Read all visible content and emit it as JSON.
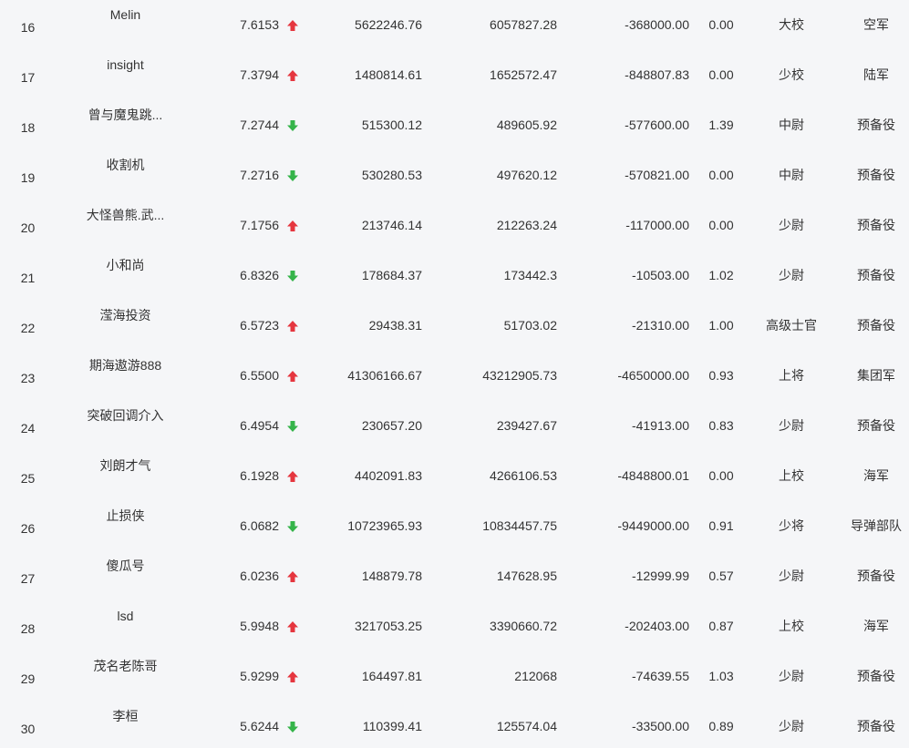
{
  "colors": {
    "up": "#e5363f",
    "down": "#35b44a",
    "background": "#f5f6f8",
    "text": "#333333"
  },
  "rows": [
    {
      "rank": "16",
      "name": "Melin",
      "score": "7.6153",
      "trend": "up",
      "v1": "5622246.76",
      "v2": "6057827.28",
      "v3": "-368000.00",
      "v4": "0.00",
      "title": "大校",
      "branch": "空军"
    },
    {
      "rank": "17",
      "name": "insight",
      "score": "7.3794",
      "trend": "up",
      "v1": "1480814.61",
      "v2": "1652572.47",
      "v3": "-848807.83",
      "v4": "0.00",
      "title": "少校",
      "branch": "陆军"
    },
    {
      "rank": "18",
      "name": "曾与魔鬼跳...",
      "score": "7.2744",
      "trend": "down",
      "v1": "515300.12",
      "v2": "489605.92",
      "v3": "-577600.00",
      "v4": "1.39",
      "title": "中尉",
      "branch": "预备役"
    },
    {
      "rank": "19",
      "name": "收割机",
      "score": "7.2716",
      "trend": "down",
      "v1": "530280.53",
      "v2": "497620.12",
      "v3": "-570821.00",
      "v4": "0.00",
      "title": "中尉",
      "branch": "预备役"
    },
    {
      "rank": "20",
      "name": "大怪兽熊.武...",
      "score": "7.1756",
      "trend": "up",
      "v1": "213746.14",
      "v2": "212263.24",
      "v3": "-117000.00",
      "v4": "0.00",
      "title": "少尉",
      "branch": "预备役"
    },
    {
      "rank": "21",
      "name": "小和尚",
      "score": "6.8326",
      "trend": "down",
      "v1": "178684.37",
      "v2": "173442.3",
      "v3": "-10503.00",
      "v4": "1.02",
      "title": "少尉",
      "branch": "预备役"
    },
    {
      "rank": "22",
      "name": "滢海投资",
      "score": "6.5723",
      "trend": "up",
      "v1": "29438.31",
      "v2": "51703.02",
      "v3": "-21310.00",
      "v4": "1.00",
      "title": "高级士官",
      "branch": "预备役"
    },
    {
      "rank": "23",
      "name": "期海遨游888",
      "score": "6.5500",
      "trend": "up",
      "v1": "41306166.67",
      "v2": "43212905.73",
      "v3": "-4650000.00",
      "v4": "0.93",
      "title": "上将",
      "branch": "集团军"
    },
    {
      "rank": "24",
      "name": "突破回调介入",
      "score": "6.4954",
      "trend": "down",
      "v1": "230657.20",
      "v2": "239427.67",
      "v3": "-41913.00",
      "v4": "0.83",
      "title": "少尉",
      "branch": "预备役"
    },
    {
      "rank": "25",
      "name": "刘朗才气",
      "score": "6.1928",
      "trend": "up",
      "v1": "4402091.83",
      "v2": "4266106.53",
      "v3": "-4848800.01",
      "v4": "0.00",
      "title": "上校",
      "branch": "海军"
    },
    {
      "rank": "26",
      "name": "止损侠",
      "score": "6.0682",
      "trend": "down",
      "v1": "10723965.93",
      "v2": "10834457.75",
      "v3": "-9449000.00",
      "v4": "0.91",
      "title": "少将",
      "branch": "导弹部队"
    },
    {
      "rank": "27",
      "name": "傻瓜号",
      "score": "6.0236",
      "trend": "up",
      "v1": "148879.78",
      "v2": "147628.95",
      "v3": "-12999.99",
      "v4": "0.57",
      "title": "少尉",
      "branch": "预备役"
    },
    {
      "rank": "28",
      "name": "lsd",
      "score": "5.9948",
      "trend": "up",
      "v1": "3217053.25",
      "v2": "3390660.72",
      "v3": "-202403.00",
      "v4": "0.87",
      "title": "上校",
      "branch": "海军"
    },
    {
      "rank": "29",
      "name": "茂名老陈哥",
      "score": "5.9299",
      "trend": "up",
      "v1": "164497.81",
      "v2": "212068",
      "v3": "-74639.55",
      "v4": "1.03",
      "title": "少尉",
      "branch": "预备役"
    },
    {
      "rank": "30",
      "name": "李桓",
      "score": "5.6244",
      "trend": "down",
      "v1": "110399.41",
      "v2": "125574.04",
      "v3": "-33500.00",
      "v4": "0.89",
      "title": "少尉",
      "branch": "预备役"
    }
  ]
}
